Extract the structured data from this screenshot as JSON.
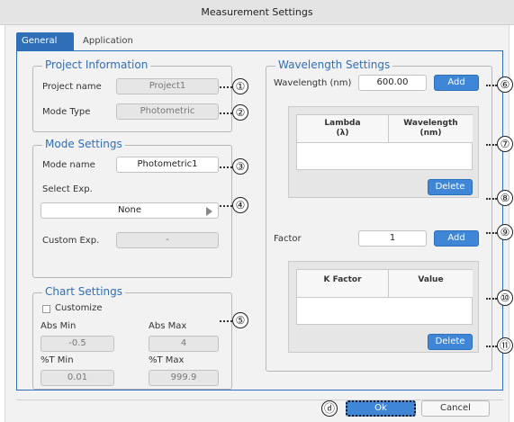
{
  "window": {
    "title": "Measurement Settings"
  },
  "tabs": [
    {
      "label": "General"
    },
    {
      "label": "Application"
    }
  ],
  "project_information": {
    "legend": "Project Information",
    "project_name_label": "Project name",
    "project_name_value": "Project1",
    "mode_type_label": "Mode Type",
    "mode_type_value": "Photometric"
  },
  "mode_settings": {
    "legend": "Mode Settings",
    "mode_name_label": "Mode name",
    "mode_name_value": "Photometric1",
    "select_exp_label": "Select Exp.",
    "select_exp_value": "None",
    "custom_exp_label": "Custom Exp.",
    "custom_exp_value": "-"
  },
  "chart_settings": {
    "legend": "Chart Settings",
    "customize_label": "Customize",
    "customize_checked": false,
    "abs_min_label": "Abs Min",
    "abs_min_value": "-0.5",
    "abs_max_label": "Abs Max",
    "abs_max_value": "4",
    "t_min_label": "%T Min",
    "t_min_value": "0.01",
    "t_max_label": "%T Max",
    "t_max_value": "999.9"
  },
  "wavelength_settings": {
    "legend": "Wavelength Settings",
    "wavelength_label": "Wavelength (nm)",
    "wavelength_value": "600.00",
    "add_label": "Add",
    "table_headers": [
      "Lambda\n(λ)",
      "Wavelength\n(nm)"
    ],
    "delete_label": "Delete"
  },
  "factor": {
    "label": "Factor",
    "value": "1",
    "add_label": "Add",
    "table_headers": [
      "K Factor",
      "Value"
    ],
    "delete_label": "Delete"
  },
  "callouts": [
    "①",
    "②",
    "③",
    "④",
    "⑤",
    "⑥",
    "⑦",
    "⑧",
    "⑨",
    "⑩",
    "⑪",
    "ⓓ"
  ],
  "footer": {
    "ok_label": "Ok",
    "cancel_label": "Cancel"
  },
  "colors": {
    "accent": "#2f6fb8",
    "button_blue": "#3f86d6",
    "background": "#f2f2f2"
  }
}
